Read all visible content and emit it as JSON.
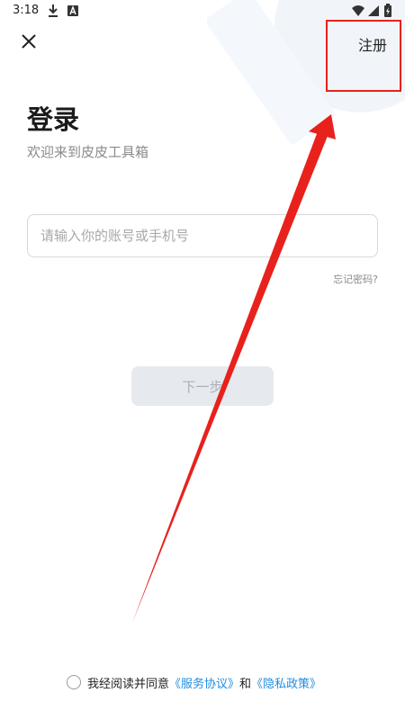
{
  "status_bar": {
    "time": "3:18",
    "icons": [
      "download-icon",
      "font-a-icon",
      "wifi-icon",
      "signal-icon",
      "battery-charging-icon"
    ]
  },
  "header": {
    "close_icon": "close-icon",
    "register_label": "注册"
  },
  "main": {
    "title": "登录",
    "subtitle": "欢迎来到皮皮工具箱",
    "account_input": {
      "placeholder": "请输入你的账号或手机号",
      "value": ""
    },
    "forgot_password_label": "忘记密码?",
    "next_button_label": "下一步"
  },
  "agreement": {
    "prefix": "我经阅读并同意",
    "service_link": "《服务协议》",
    "and": "和",
    "privacy_link": "《隐私政策》"
  },
  "colors": {
    "accent_link": "#1f8de0",
    "annotation_red": "#e8211c",
    "button_disabled_bg": "#e6eaee"
  }
}
